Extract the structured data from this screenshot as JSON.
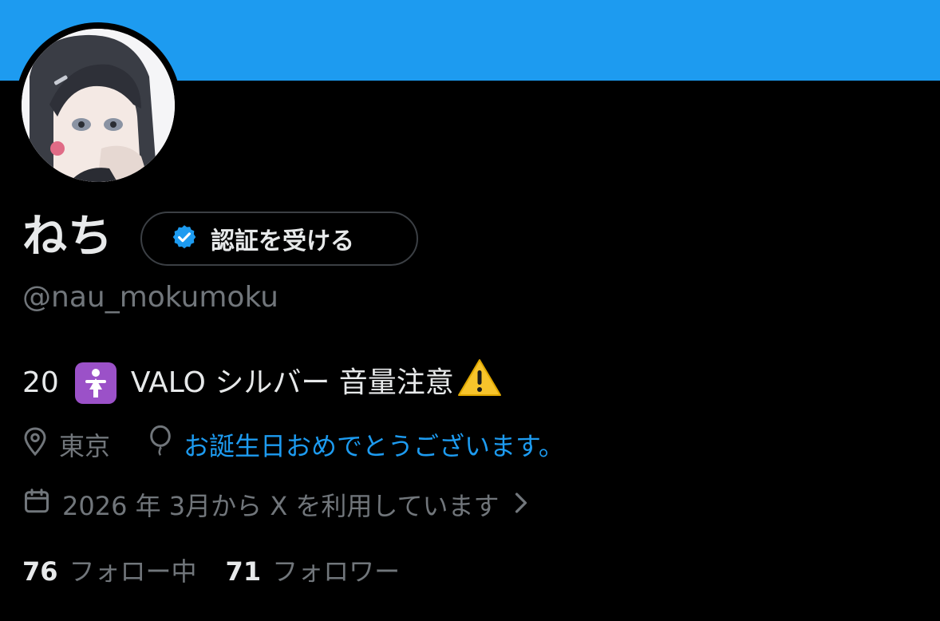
{
  "profile": {
    "display_name": "ねち",
    "verify_button_label": "認証を受ける",
    "handle": "@nau_mokumoku",
    "bio": {
      "age": "20",
      "emoji_icon": "woman-symbol-emoji",
      "text": "VALO シルバー 音量注意",
      "warning_icon": "warning-emoji"
    },
    "location": "東京",
    "birthday_text": "お誕生日おめでとうございます。",
    "joined_text": "2026 年 3月から X を利用しています",
    "following_count": "76",
    "following_label": "フォロー中",
    "followers_count": "71",
    "followers_label": "フォロワー"
  },
  "colors": {
    "banner": "#1d9bf0",
    "link": "#1d9bf0",
    "muted": "#71767b",
    "text": "#e7e9ea"
  }
}
